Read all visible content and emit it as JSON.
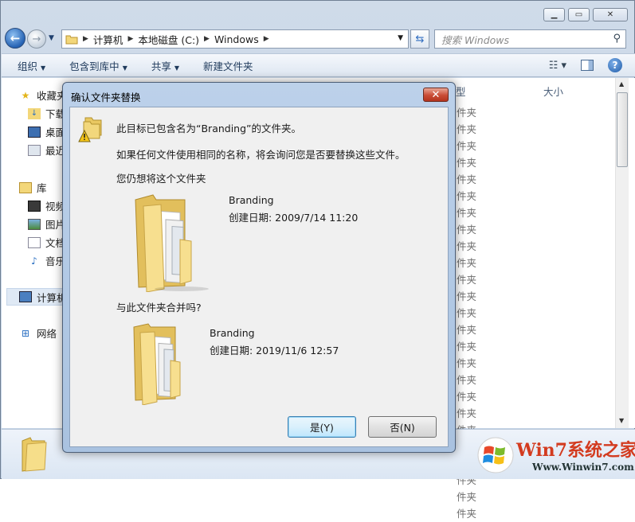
{
  "explorer": {
    "window_controls": {
      "minimize": "▁",
      "maximize": "▭",
      "close": "✕"
    },
    "address": {
      "crumbs": [
        "计算机",
        "本地磁盘 (C:)",
        "Windows"
      ]
    },
    "search": {
      "placeholder": "搜索 Windows"
    },
    "toolbar": {
      "organize": "组织",
      "include": "包含到库中",
      "share": "共享",
      "new_folder": "新建文件夹"
    },
    "columns": {
      "type": "型",
      "size": "大小"
    },
    "type_values": [
      "件夹",
      "件夹",
      "件夹",
      "件夹",
      "件夹",
      "件夹",
      "件夹",
      "件夹",
      "件夹",
      "件夹",
      "件夹",
      "件夹",
      "件夹",
      "件夹",
      "件夹",
      "件夹",
      "件夹",
      "件夹",
      "件夹",
      "件夹",
      "件夹",
      "件夹",
      "件夹",
      "件夹",
      "件夹"
    ],
    "sidebar": {
      "favorites": "收藏夹",
      "downloads": "下载",
      "desktop": "桌面",
      "recent": "最近",
      "libraries": "库",
      "videos": "视频",
      "pictures": "图片",
      "documents": "文档",
      "music": "音乐",
      "computer": "计算机",
      "network": "网络"
    }
  },
  "dialog": {
    "title": "确认文件夹替换",
    "close_label": "✕",
    "message1": "此目标已包含名为“Branding”的文件夹。",
    "message2": "如果任何文件使用相同的名称，将会询问您是否要替换这些文件。",
    "question1": "您仍想将这个文件夹",
    "source": {
      "name": "Branding",
      "date": "创建日期: 2009/7/14 11:20"
    },
    "question2": "与此文件夹合并吗?",
    "target": {
      "name": "Branding",
      "date": "创建日期: 2019/11/6 12:57"
    },
    "yes": "是(Y)",
    "no": "否(N)"
  },
  "watermark": {
    "title": "Win7系统之家",
    "url": "Www.Winwin7.com"
  },
  "colors": {
    "accent": "#2663b4",
    "dialog_frame": "#a9c2e0",
    "close_red": "#c94c36",
    "watermark_red": "#d33b1f"
  }
}
